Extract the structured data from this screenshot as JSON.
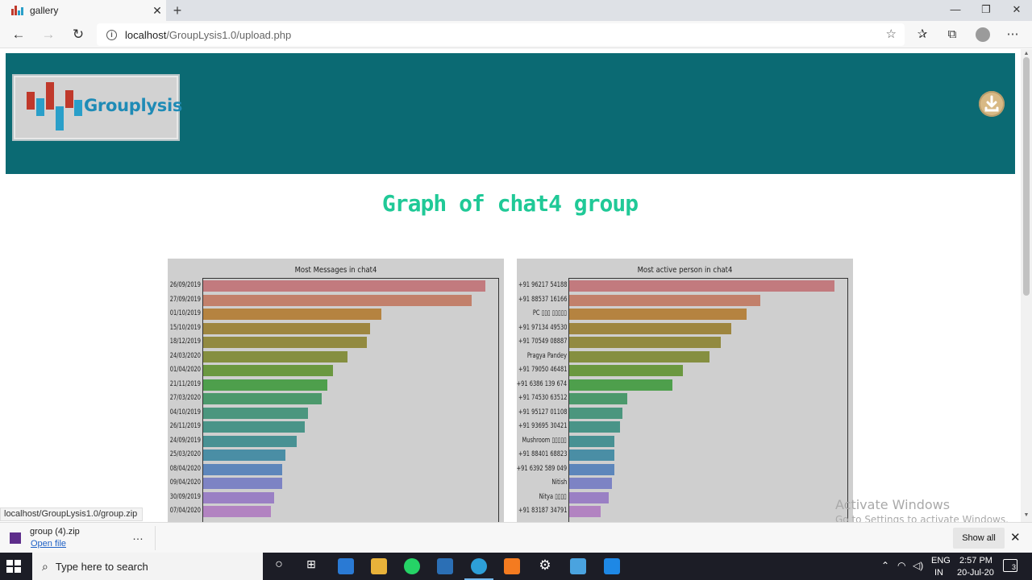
{
  "browser": {
    "tab_title": "gallery",
    "new_tab": "+",
    "url_host": "localhost",
    "url_path": "/GroupLysis1.0/upload.php",
    "status_url": "localhost/GroupLysis1.0/group.zip"
  },
  "site": {
    "logo_text": "Grouplysis",
    "heading": "Graph of chat4 group"
  },
  "charts": [
    {
      "type": "bar",
      "orientation": "horizontal",
      "title": "Most Messages in chat4",
      "categories": [
        "26/09/2019",
        "27/09/2019",
        "01/10/2019",
        "15/10/2019",
        "18/12/2019",
        "24/03/2020",
        "01/04/2020",
        "21/11/2019",
        "27/03/2020",
        "04/10/2019",
        "26/11/2019",
        "24/09/2019",
        "25/03/2020",
        "08/04/2020",
        "09/04/2020",
        "30/09/2019",
        "07/04/2020"
      ],
      "values": [
        100,
        95,
        63,
        59,
        58,
        51,
        46,
        44,
        42,
        37,
        36,
        33,
        29,
        28,
        28,
        25,
        24
      ],
      "colors": [
        "#c27a7e",
        "#c2806b",
        "#b58340",
        "#9e8640",
        "#928a40",
        "#858f40",
        "#6b9840",
        "#4e9f4c",
        "#4c996c",
        "#4b967e",
        "#499488",
        "#489193",
        "#4a8ea5",
        "#5d86bb",
        "#7d83c4",
        "#9a80c4",
        "#b283c1"
      ]
    },
    {
      "type": "bar",
      "orientation": "horizontal",
      "title": "Most active person in chat4",
      "categories": [
        "+91 96217 54188",
        "+91 88537 16166",
        "PC ▯▯▯ ▯▯▯▯▯",
        "+91 97134 49530",
        "+91 70549 08887",
        "Pragya Pandey",
        "+91 79050 46481",
        "+91 6386 139 674",
        "+91 74530 63512",
        "+91 95127 01108",
        "+91 93695 30421",
        "Mushroom ▯▯▯▯▯",
        "+91 88401 68823",
        "+91 6392 589 049",
        "Nitish",
        "Nitya ▯▯▯▯",
        "+91 83187 34791"
      ],
      "values": [
        100,
        72,
        67,
        61,
        57,
        53,
        43,
        39,
        22,
        20,
        19,
        17,
        17,
        17,
        16,
        15,
        12
      ],
      "colors": [
        "#c27a7e",
        "#c2806b",
        "#b58340",
        "#9e8640",
        "#928a40",
        "#858f40",
        "#6b9840",
        "#4e9f4c",
        "#4c996c",
        "#4b967e",
        "#499488",
        "#489193",
        "#4a8ea5",
        "#5d86bb",
        "#7d83c4",
        "#9a80c4",
        "#b283c1"
      ]
    }
  ],
  "download": {
    "file_name": "group (4).zip",
    "open_label": "Open file",
    "more": "…",
    "show_all": "Show all"
  },
  "watermark": {
    "line1": "Activate Windows",
    "line2": "Go to Settings to activate Windows."
  },
  "taskbar": {
    "search_placeholder": "Type here to search",
    "lang1": "ENG",
    "lang2": "IN",
    "time": "2:57 PM",
    "date": "20-Jul-20",
    "notification_count": "3"
  },
  "colors": {
    "header_bg": "#0b6a73",
    "heading": "#20c997",
    "chart_bg": "#cfcfcf"
  }
}
